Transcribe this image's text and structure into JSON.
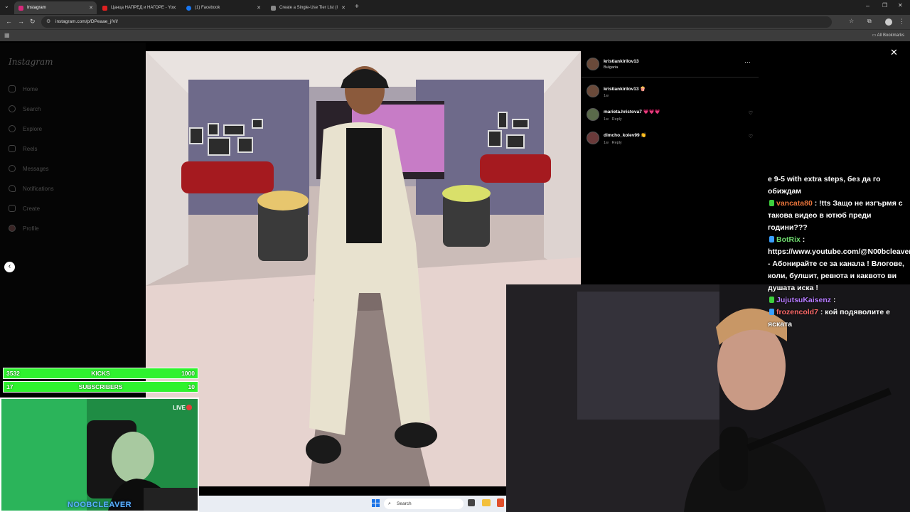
{
  "browser": {
    "tabs": [
      {
        "label": "Instagram",
        "active": true,
        "icon": "instagram-icon"
      },
      {
        "label": "Цанца НАПРЕД и НАГОРЕ - Yo",
        "active": false,
        "icon": "youtube-icon"
      },
      {
        "label": "(1) Facebook",
        "active": false,
        "icon": "facebook-icon"
      },
      {
        "label": "Create a Single-Use Tier List (I",
        "active": false,
        "icon": "tierlist-icon"
      }
    ],
    "url": "instagram.com/p/DPeaae_jIVl/",
    "all_bookmarks": "All Bookmarks"
  },
  "instagram": {
    "logo": "Instagram",
    "nav": [
      {
        "label": "Home",
        "icon": "home-icon"
      },
      {
        "label": "Search",
        "icon": "search-icon"
      },
      {
        "label": "Explore",
        "icon": "compass-icon"
      },
      {
        "label": "Reels",
        "icon": "reels-icon"
      },
      {
        "label": "Messages",
        "icon": "messenger-icon"
      },
      {
        "label": "Notifications",
        "icon": "heart-icon"
      },
      {
        "label": "Create",
        "icon": "plus-icon"
      },
      {
        "label": "Profile",
        "icon": "avatar-icon"
      }
    ],
    "post": {
      "author": "kristiankirilov13",
      "location": "Bulgaria",
      "caption_user": "kristiankirilov13",
      "caption_emoji": "🍿",
      "caption_time": "1w",
      "comments": [
        {
          "user": "marieta.hristova7",
          "text": "💗💗💗",
          "time": "1w",
          "reply": "Reply"
        },
        {
          "user": "dimcho_kolev99",
          "text": "👏",
          "time": "1w",
          "reply": "Reply"
        }
      ],
      "more": "···"
    }
  },
  "chat": {
    "lines": [
      {
        "user": "",
        "text": "е 9-5 with extra steps, без да го обиждам"
      },
      {
        "user": "vancata80",
        "text": ": !tts Защо не изгърмя с такова видео в ютюб преди години???"
      },
      {
        "user": "BotRix",
        "text": ": https://www.youtube.com/@N00bcleaver - Абонирайте се за канала ! Влогове, коли, булшит, ревюта и каквото ви душата иска !"
      },
      {
        "user": "JujutsuKaisenz",
        "text": ":"
      },
      {
        "user": "frozencold7",
        "text": ": кой подяволите е яската"
      }
    ]
  },
  "overlay": {
    "kicks": {
      "count": "3532",
      "label": "KICKS",
      "goal": "1000"
    },
    "subs": {
      "count": "17",
      "label": "SUBSCRIBERS",
      "goal": "10"
    },
    "live": "LIVE",
    "streamer": "NOOBCLEAVER"
  },
  "taskbar": {
    "search": "Search"
  },
  "colors": {
    "kick_green": "#2ef22e",
    "ig_bg": "#000000"
  }
}
